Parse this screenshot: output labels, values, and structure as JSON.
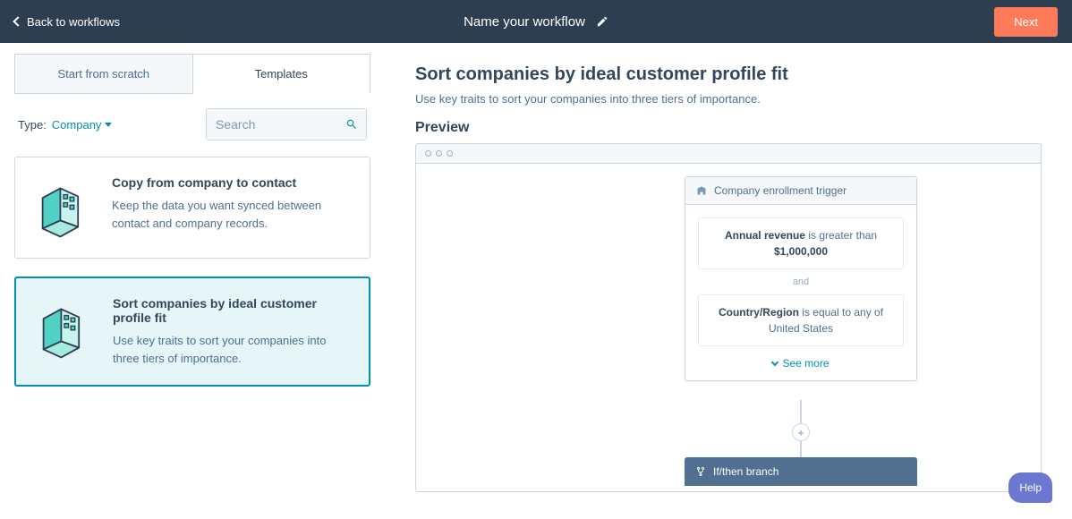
{
  "header": {
    "back_label": "Back to workflows",
    "title": "Name your workflow",
    "next_label": "Next"
  },
  "tabs": {
    "scratch": "Start from scratch",
    "templates": "Templates"
  },
  "filter": {
    "type_label": "Type:",
    "type_value": "Company",
    "search_placeholder": "Search"
  },
  "templates": [
    {
      "title": "Copy from company to contact",
      "desc": "Keep the data you want synced between contact and company records.",
      "selected": false
    },
    {
      "title": "Sort companies by ideal customer profile fit",
      "desc": "Use key traits to sort your companies into three tiers of importance.",
      "selected": true
    }
  ],
  "detail": {
    "title": "Sort companies by ideal customer profile fit",
    "subtitle": "Use key traits to sort your companies into three tiers of importance.",
    "preview_label": "Preview"
  },
  "workflow": {
    "trigger_label": "Company enrollment trigger",
    "cond1_prop": "Annual revenue",
    "cond1_mid": " is greater than ",
    "cond1_val": "$1,000,000",
    "and_label": "and",
    "cond2_prop": "Country/Region",
    "cond2_mid": " is equal to any of ",
    "cond2_val": "United States",
    "see_more": "See more",
    "plus": "+",
    "branch_label": "If/then branch"
  },
  "help": "Help"
}
